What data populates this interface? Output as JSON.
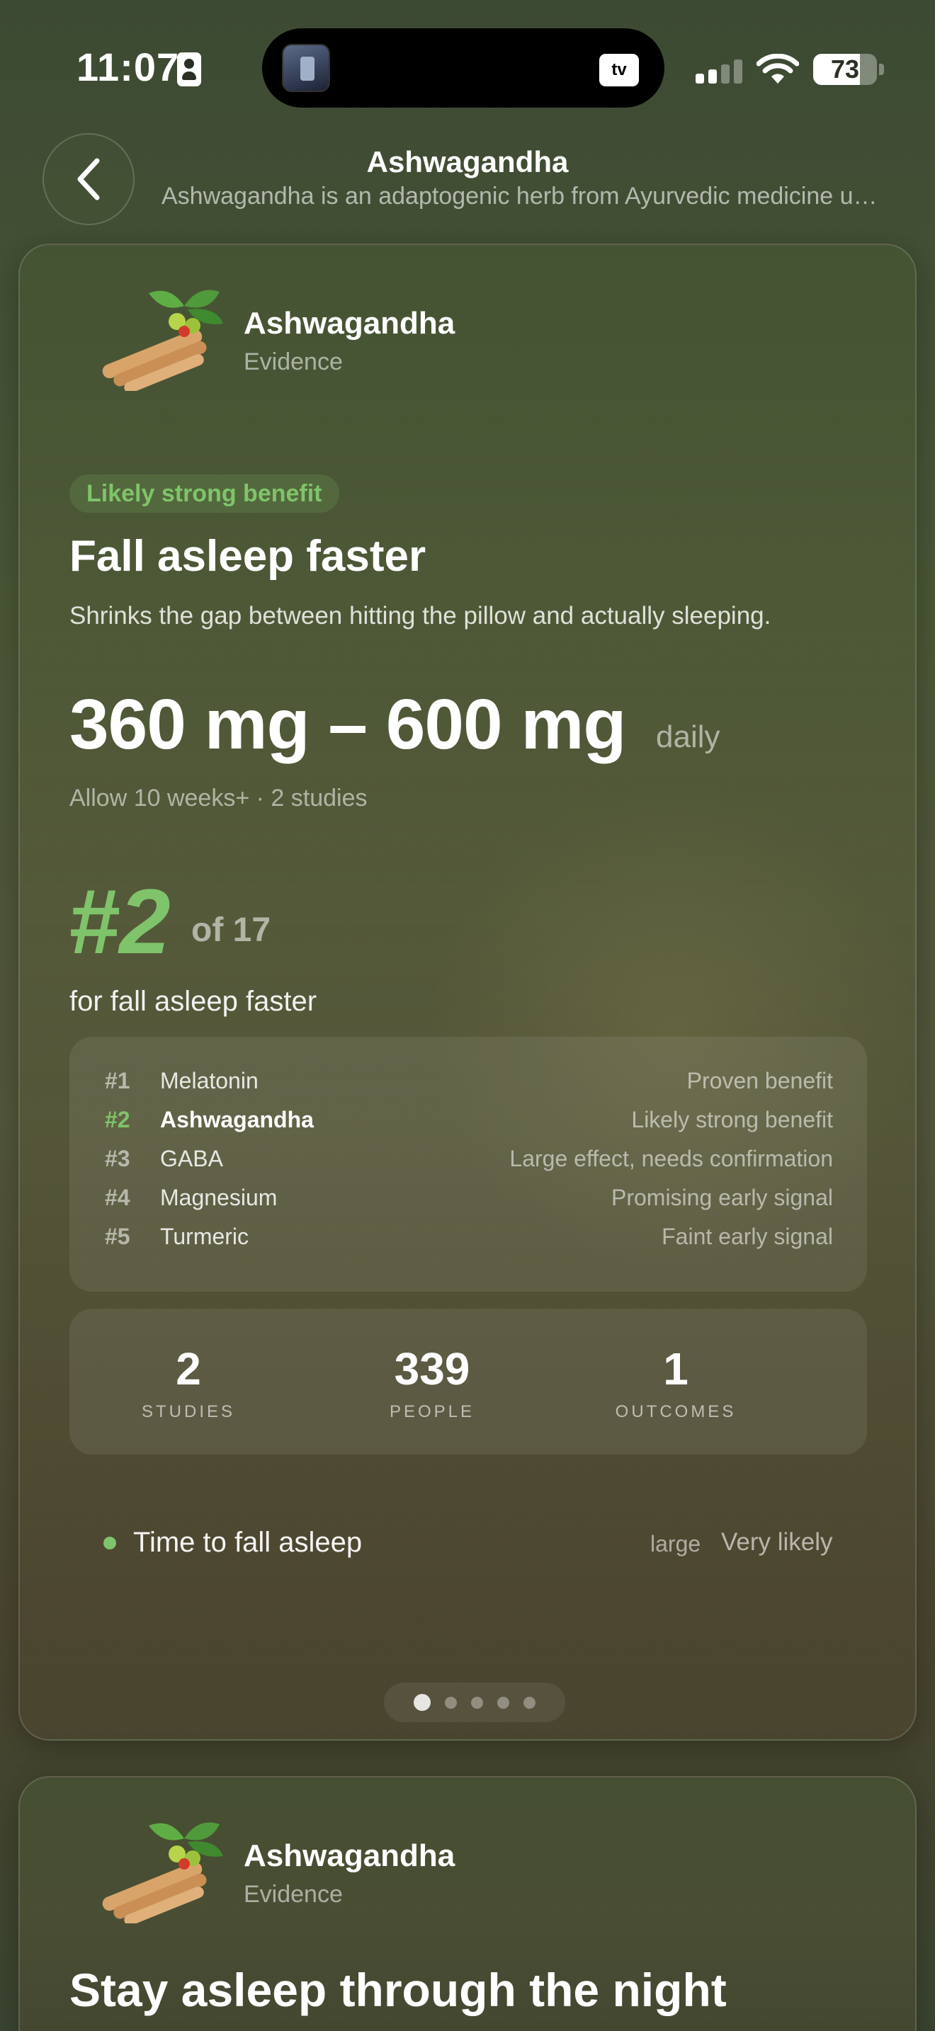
{
  "status_bar": {
    "time": "11:07",
    "island_app_icon": "music-app-icon",
    "island_tv_label": "tv",
    "battery_percent": "73",
    "battery_level": 0.73,
    "signal_bars_active": 2
  },
  "header": {
    "title": "Ashwagandha",
    "subtitle": "Ashwagandha is an adaptogenic herb from Ayurvedic medicine used for stress and sleep"
  },
  "card": {
    "name": "Ashwagandha",
    "label": "Evidence",
    "badge": "Likely strong benefit",
    "benefit_title": "Fall asleep faster",
    "benefit_desc": "Shrinks the gap between hitting the pillow and actually sleeping.",
    "dose": "360 mg – 600 mg",
    "dose_unit": "daily",
    "dose_meta": "Allow 10 weeks+ · 2 studies",
    "rank": "#2",
    "rank_of": "of 17",
    "rank_for": "for fall asleep faster",
    "ranking": [
      {
        "rank": "#1",
        "name": "Melatonin",
        "level": "Proven benefit"
      },
      {
        "rank": "#2",
        "name": "Ashwagandha",
        "level": "Likely strong benefit"
      },
      {
        "rank": "#3",
        "name": "GABA",
        "level": "Large effect, needs confirmation"
      },
      {
        "rank": "#4",
        "name": "Magnesium",
        "level": "Promising early signal"
      },
      {
        "rank": "#5",
        "name": "Turmeric",
        "level": "Faint early signal"
      }
    ],
    "stats": [
      {
        "value": "2",
        "label": "STUDIES"
      },
      {
        "value": "339",
        "label": "PEOPLE"
      },
      {
        "value": "1",
        "label": "OUTCOMES"
      }
    ],
    "outcome": {
      "name": "Time to fall asleep",
      "effect_size": "large",
      "confidence": "Very likely"
    },
    "pager": {
      "total": 5,
      "active": 1
    }
  },
  "card2": {
    "name": "Ashwagandha",
    "label": "Evidence",
    "benefit_title": "Stay asleep through the night"
  },
  "colors": {
    "accent_green": "#7fc46a",
    "background": "#4a5636"
  }
}
